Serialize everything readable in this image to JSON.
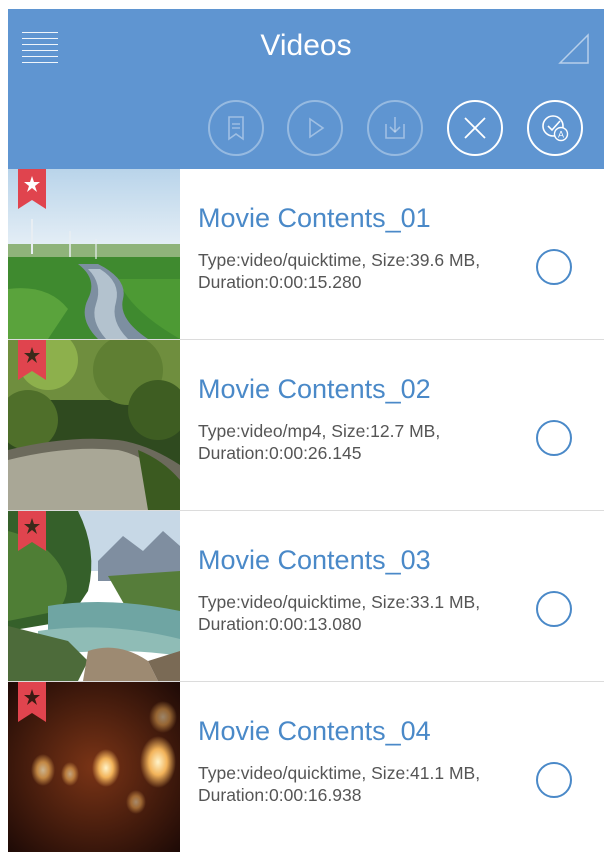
{
  "header": {
    "title": "Videos",
    "menu_icon": "hamburger-menu-icon",
    "corner_icon": "triangle-corner-icon"
  },
  "toolbar": {
    "buttons": [
      {
        "icon": "bookmark-icon",
        "enabled": false
      },
      {
        "icon": "play-icon",
        "enabled": false
      },
      {
        "icon": "download-icon",
        "enabled": false
      },
      {
        "icon": "close-icon",
        "enabled": true
      },
      {
        "icon": "select-all-icon",
        "enabled": true
      }
    ]
  },
  "videos": [
    {
      "title": "Movie Contents_01",
      "details": "Type:video/quicktime, Size:39.6 MB, Duration:0:00:15.280",
      "favorite": true,
      "thumbnail": "green field path"
    },
    {
      "title": "Movie Contents_02",
      "details": "Type:video/mp4, Size:12.7 MB, Duration:0:00:26.145",
      "favorite": true,
      "thumbnail": "forest path"
    },
    {
      "title": "Movie Contents_03",
      "details": "Type:video/quicktime, Size:33.1 MB, Duration:0:00:13.080",
      "favorite": true,
      "thumbnail": "river mountains"
    },
    {
      "title": "Movie Contents_04",
      "details": "Type:video/quicktime, Size:41.1 MB, Duration:0:00:16.938",
      "favorite": true,
      "thumbnail": "bokeh lights"
    }
  ],
  "colors": {
    "header_bg": "#5f95d1",
    "title_text": "#4a89c8",
    "ribbon": "#e0444e",
    "detail_text": "#555555"
  }
}
